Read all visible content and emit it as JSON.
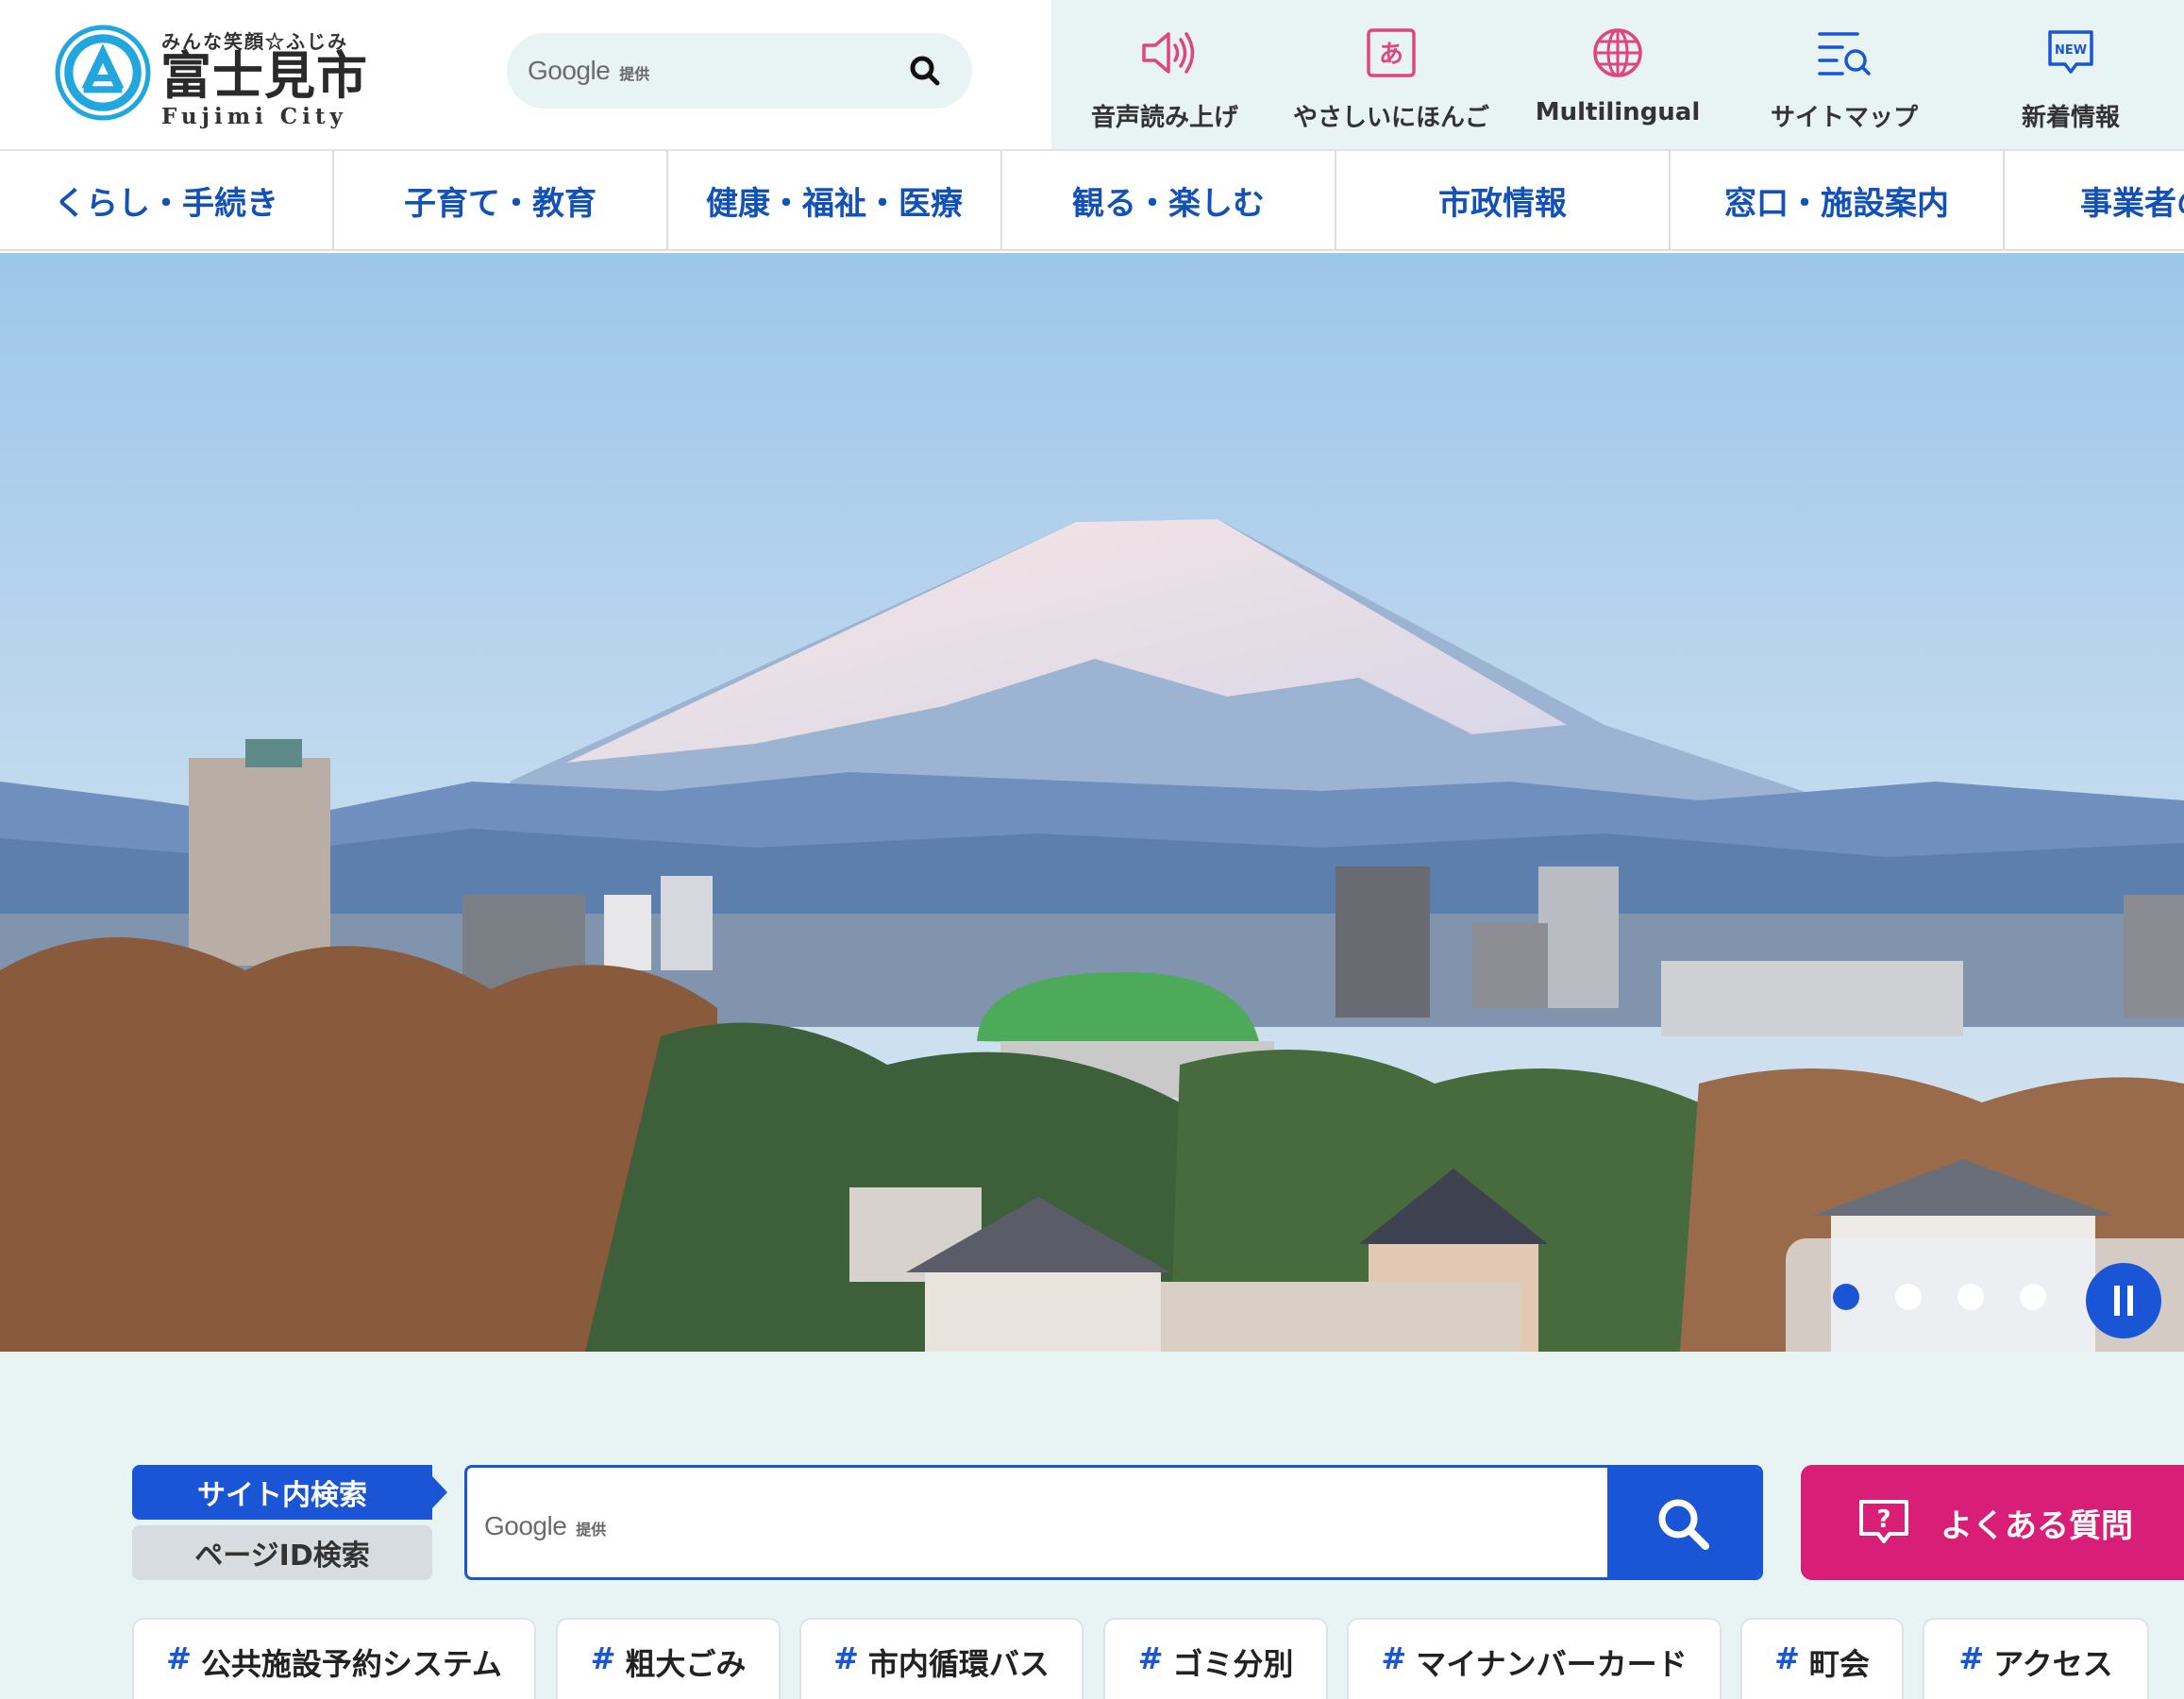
{
  "header": {
    "logo": {
      "tagline": "みんな笑顔☆ふじみ",
      "name": "富士見市",
      "romaji": "Fujimi City"
    },
    "search": {
      "brand": "Google",
      "provided": "提供",
      "placeholder": ""
    },
    "utilities": [
      {
        "label": "音声読み上げ",
        "icon": "speaker-icon"
      },
      {
        "label": "やさしいにほんご",
        "icon": "hiragana-a-icon",
        "glyph": "あ"
      },
      {
        "label": "Multilingual",
        "icon": "globe-icon"
      },
      {
        "label": "サイトマップ",
        "icon": "sitemap-search-icon"
      },
      {
        "label": "新着情報",
        "icon": "new-badge-icon",
        "glyph": "NEW"
      }
    ]
  },
  "nav": {
    "items": [
      "くらし・手続き",
      "子育て・教育",
      "健康・福祉・医療",
      "観る・楽しむ",
      "市政情報",
      "窓口・施設案内",
      "事業者の"
    ]
  },
  "hero": {
    "slides_total": 4,
    "active_slide": 1
  },
  "search_section": {
    "tab_site": "サイト内検索",
    "tab_page_id": "ページID検索",
    "brand": "Google",
    "provided": "提供",
    "placeholder": "",
    "faq_label": "よくある質問",
    "tags": [
      "公共施設予約システム",
      "粗大ごみ",
      "市内循環バス",
      "ゴミ分別",
      "マイナンバーカード",
      "町会",
      "アクセス"
    ],
    "tag_prefix": "#"
  },
  "colors": {
    "brand_blue": "#1a55d6",
    "nav_text": "#1252b8",
    "accent_pink": "#e0457f",
    "faq_magenta": "#d81e76",
    "panel_bg": "#e8f3f4"
  }
}
